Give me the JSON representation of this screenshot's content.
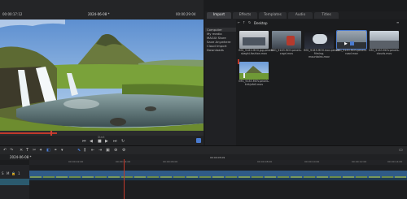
{
  "preview": {
    "timecode_left": "00:00:17:12",
    "title": "2024-06-08 *",
    "timecode_right": "00:00:29:04",
    "scrub_position": 0.28,
    "marker_label": "Start"
  },
  "media_pool": {
    "tabs": [
      "Import",
      "Effects",
      "Templates",
      "Audio",
      "Titles"
    ],
    "active_tab": "Import",
    "path_label": "Desktop",
    "folders": [
      "Computer",
      "My media",
      "MAGIX Store",
      "Save Anywhere",
      "Cloud Import",
      "Downloads"
    ],
    "selected_folder": "Computer",
    "items": [
      {
        "label": "IMG_9183.MOV.jpg.pexels-skaghi-fashion.mov"
      },
      {
        "label": "IMG_9183.MOV.pexels-cagri.mov"
      },
      {
        "label": "IMG_9183.MOV.mov.pexels-filming-mountains.mov"
      },
      {
        "label": "IMG_9183.MOV.pexels-road.mov"
      },
      {
        "label": "IMG_9183.MOV.pexels-clouds.mov"
      },
      {
        "label": "IMG_9183.MOV.pexels-kirkjufell.mov"
      }
    ]
  },
  "timeline": {
    "timecode": "2024-06-08 *",
    "ruler_marks": [
      "00:00:02:00",
      "00:00:04:00",
      "00:00:06:00",
      "00:00:08:00",
      "00:00:10:00",
      "00:00:12:00",
      "00:00:14:00",
      "00:00:16:00"
    ],
    "playhead_label": "00:00:05:09",
    "track_number": "1"
  },
  "icons": {
    "play": "play-icon",
    "stop": "stop-icon",
    "undo": "undo-icon",
    "redo": "redo-icon",
    "cut": "scissors-icon"
  },
  "colors": {
    "accent": "#4a7bd0",
    "playhead": "#c0392b",
    "clip": "#3b6a9a"
  }
}
